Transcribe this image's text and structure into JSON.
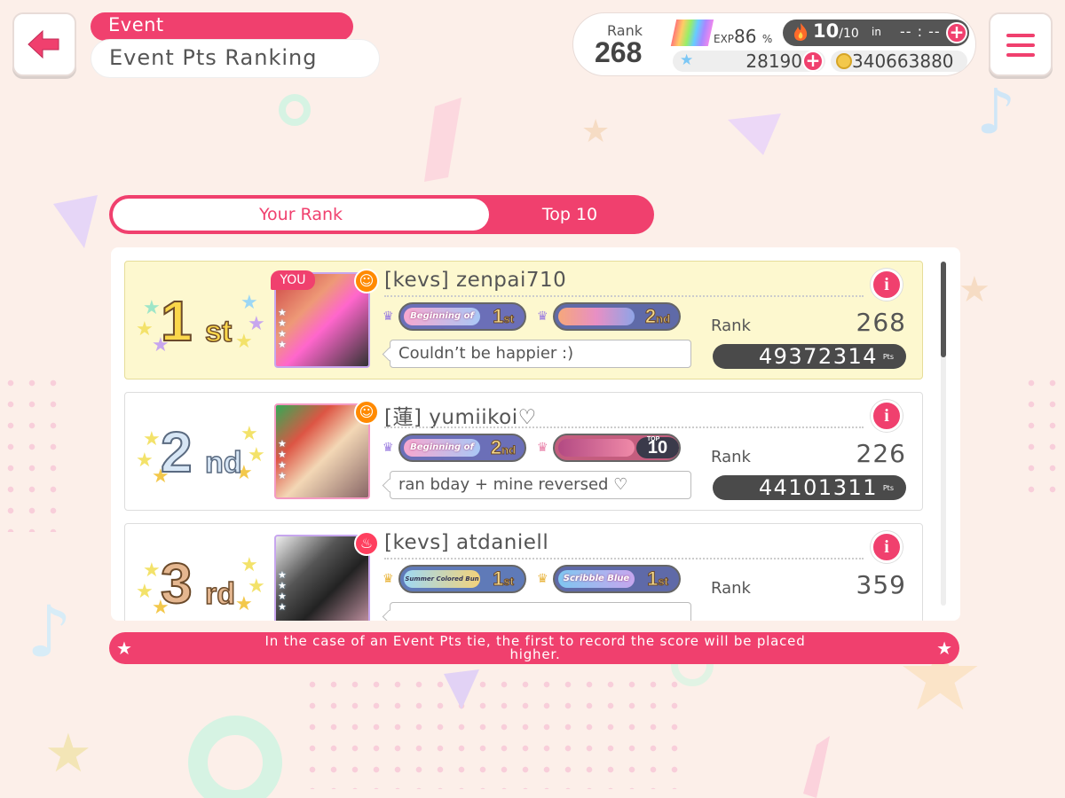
{
  "header": {
    "category": "Event",
    "title": "Event Pts Ranking"
  },
  "status": {
    "rank_label": "Rank",
    "rank_value": "268",
    "exp_label": "EXP",
    "exp_value": "86",
    "exp_unit": "%",
    "live_count": "10",
    "live_max": "/10",
    "live_in": "in",
    "live_timer": "-- : --",
    "stars": "28190",
    "coins": "340663880"
  },
  "tabs": {
    "your_rank": "Your Rank",
    "top10": "Top 10"
  },
  "ranking": [
    {
      "place": "1",
      "place_suffix": "st",
      "is_you": true,
      "you_label": "YOU",
      "name": "[kevs] zenpai710",
      "badge1_label": "Beginning of spring!",
      "badge1_rank": "1",
      "badge1_suffix": "st",
      "badge2_label": "",
      "badge2_rank": "2",
      "badge2_suffix": "nd",
      "comment": "Couldn’t be happier :)",
      "rank_label": "Rank",
      "rank": "268",
      "points": "49372314",
      "pts_unit": "Pts"
    },
    {
      "place": "2",
      "place_suffix": "nd",
      "is_you": false,
      "name": "[蓮] yumiikoi♡",
      "badge1_label": "Beginning of spring!",
      "badge1_rank": "2",
      "badge1_suffix": "nd",
      "badge2_label": "",
      "badge2_top": "TOP",
      "badge2_rank": "10",
      "comment": "ran bday + mine reversed ♡",
      "rank_label": "Rank",
      "rank": "226",
      "points": "44101311",
      "pts_unit": "Pts"
    },
    {
      "place": "3",
      "place_suffix": "rd",
      "is_you": false,
      "name": "[kevs] atdaniell",
      "badge1_label": "Summer Colored Bun hin Days",
      "badge1_rank": "1",
      "badge1_suffix": "st",
      "badge2_label": "Scribble Blue",
      "badge2_rank": "1",
      "badge2_suffix": "st",
      "comment": "",
      "rank_label": "Rank",
      "rank": "359",
      "points": "",
      "pts_unit": ""
    }
  ],
  "footer": {
    "note": "In the case of an Event Pts tie, the first to record the score will be placed higher."
  },
  "icons": [
    "back-arrow-icon",
    "menu-icon",
    "flame-icon",
    "star-icon",
    "coin-icon",
    "info-icon",
    "crown-icon",
    "happy-attribute-icon",
    "power-attribute-icon"
  ],
  "colors": {
    "accent": "#f0406e",
    "background": "#fcefe9",
    "highlight_row": "#fdf8cf",
    "dark": "#4a4a4a"
  }
}
